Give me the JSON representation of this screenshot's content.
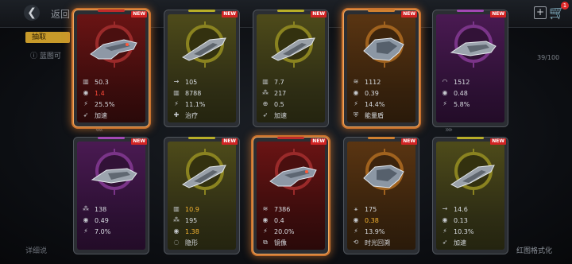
{
  "header": {
    "back_label": "返回",
    "cart_badge": "1"
  },
  "side": {
    "tag": "抽取",
    "info": "蓝图可"
  },
  "counter": "39/100",
  "footer": {
    "left": "详细说",
    "right": "红图格式化"
  },
  "new_label": "NEW",
  "cards": [
    {
      "theme": "red",
      "selected": true,
      "ship": "red",
      "stats": [
        {
          "icon": "damage-icon",
          "sym": "▥",
          "value": "50.3",
          "color": ""
        },
        {
          "icon": "reload-icon",
          "sym": "◉",
          "value": "1.4",
          "color": "red"
        },
        {
          "icon": "crit-icon",
          "sym": "⚡",
          "value": "25.5%",
          "color": ""
        },
        {
          "icon": "speed-icon",
          "sym": "➶",
          "value": "加速",
          "color": ""
        }
      ]
    },
    {
      "theme": "yel",
      "selected": false,
      "ship": "yel",
      "stats": [
        {
          "icon": "range-icon",
          "sym": "→",
          "value": "105",
          "color": ""
        },
        {
          "icon": "damage-icon",
          "sym": "▥",
          "value": "8788",
          "color": ""
        },
        {
          "icon": "crit-icon",
          "sym": "⚡",
          "value": "11.1%",
          "color": ""
        },
        {
          "icon": "heal-icon",
          "sym": "✚",
          "value": "治疗",
          "color": ""
        }
      ]
    },
    {
      "theme": "yel",
      "selected": false,
      "ship": "yel",
      "stats": [
        {
          "icon": "damage-icon",
          "sym": "▥",
          "value": "7.7",
          "color": ""
        },
        {
          "icon": "shots-icon",
          "sym": "⁂",
          "value": "217",
          "color": ""
        },
        {
          "icon": "aim-icon",
          "sym": "⊕",
          "value": "0.5",
          "color": ""
        },
        {
          "icon": "speed-icon",
          "sym": "➶",
          "value": "加速",
          "color": ""
        }
      ]
    },
    {
      "theme": "ora",
      "selected": true,
      "ship": "ora",
      "stats": [
        {
          "icon": "hull-icon",
          "sym": "≋",
          "value": "1112",
          "color": ""
        },
        {
          "icon": "reload-icon",
          "sym": "◉",
          "value": "0.39",
          "color": ""
        },
        {
          "icon": "crit-icon",
          "sym": "⚡",
          "value": "14.4%",
          "color": ""
        },
        {
          "icon": "shield-icon",
          "sym": "⛨",
          "value": "能量盾",
          "color": ""
        }
      ]
    },
    {
      "theme": "pur",
      "selected": false,
      "ship": "pur",
      "stats": [
        {
          "icon": "signal-icon",
          "sym": "◠",
          "value": "1512",
          "color": ""
        },
        {
          "icon": "reload-icon",
          "sym": "◉",
          "value": "0.48",
          "color": ""
        },
        {
          "icon": "crit-icon",
          "sym": "⚡",
          "value": "5.8%",
          "color": ""
        }
      ]
    },
    {
      "theme": "pur",
      "selected": false,
      "ship": "pur",
      "stats": [
        {
          "icon": "shots-icon",
          "sym": "⁂",
          "value": "138",
          "color": ""
        },
        {
          "icon": "reload-icon",
          "sym": "◉",
          "value": "0.49",
          "color": ""
        },
        {
          "icon": "crit-icon",
          "sym": "⚡",
          "value": "7.0%",
          "color": ""
        }
      ]
    },
    {
      "theme": "yel",
      "selected": false,
      "ship": "yel",
      "stats": [
        {
          "icon": "damage-icon",
          "sym": "▥",
          "value": "10.9",
          "color": "gold"
        },
        {
          "icon": "shots-icon",
          "sym": "⁂",
          "value": "195",
          "color": ""
        },
        {
          "icon": "reload-icon",
          "sym": "◉",
          "value": "1.38",
          "color": "gold"
        },
        {
          "icon": "stealth-icon",
          "sym": "◌",
          "value": "隐形",
          "color": ""
        }
      ]
    },
    {
      "theme": "red",
      "selected": true,
      "ship": "red",
      "stats": [
        {
          "icon": "hull-icon",
          "sym": "≋",
          "value": "7386",
          "color": ""
        },
        {
          "icon": "reload-icon",
          "sym": "◉",
          "value": "0.4",
          "color": ""
        },
        {
          "icon": "crit-icon",
          "sym": "⚡",
          "value": "20.0%",
          "color": ""
        },
        {
          "icon": "mirror-icon",
          "sym": "⧉",
          "value": "镜像",
          "color": ""
        }
      ]
    },
    {
      "theme": "ora",
      "selected": false,
      "ship": "ora",
      "stats": [
        {
          "icon": "range-icon",
          "sym": "⚹",
          "value": "175",
          "color": ""
        },
        {
          "icon": "reload-icon",
          "sym": "◉",
          "value": "0.38",
          "color": "gold"
        },
        {
          "icon": "crit-icon",
          "sym": "⚡",
          "value": "13.9%",
          "color": ""
        },
        {
          "icon": "rewind-icon",
          "sym": "⟲",
          "value": "时光回溯",
          "color": ""
        }
      ]
    },
    {
      "theme": "yel",
      "selected": false,
      "ship": "yel",
      "stats": [
        {
          "icon": "range-icon",
          "sym": "→",
          "value": "14.6",
          "color": ""
        },
        {
          "icon": "reload-icon",
          "sym": "◉",
          "value": "0.13",
          "color": ""
        },
        {
          "icon": "crit-icon",
          "sym": "⚡",
          "value": "10.3%",
          "color": ""
        },
        {
          "icon": "speed-icon",
          "sym": "➶",
          "value": "加速",
          "color": ""
        }
      ]
    }
  ]
}
